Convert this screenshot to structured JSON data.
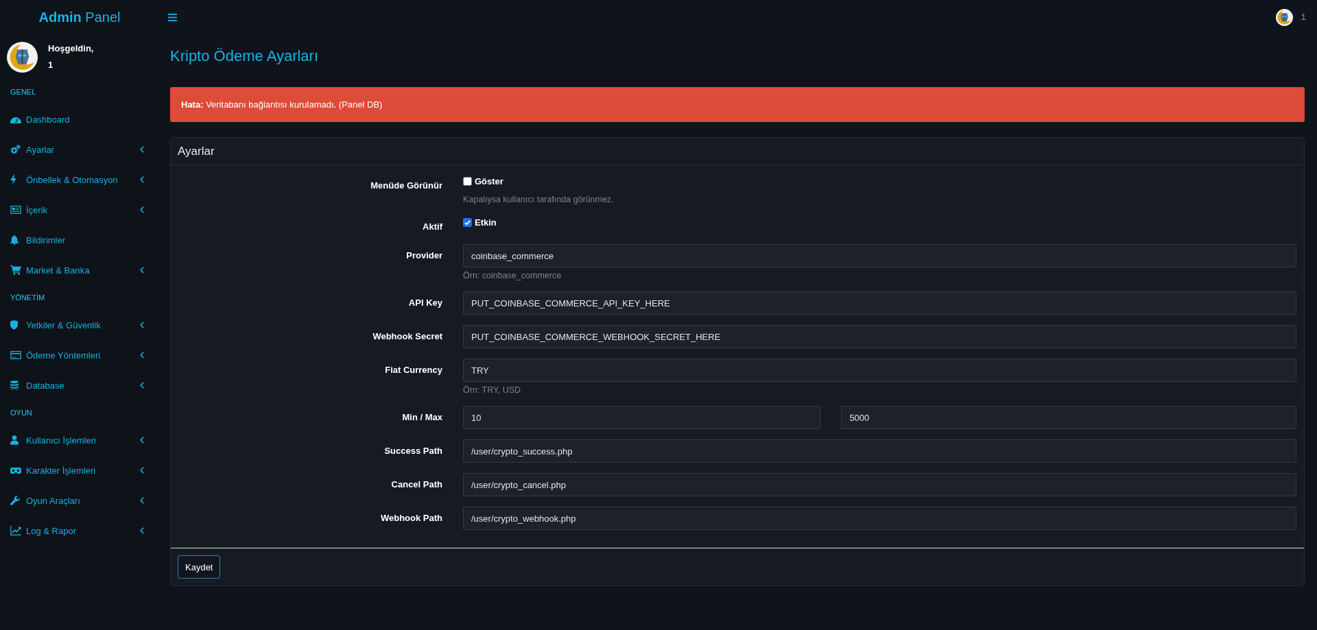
{
  "sidebar": {
    "brand": "**Admin** Panel",
    "user": {
      "greeting": "Hoşgeldin,",
      "name": "1"
    },
    "sections": [
      {
        "heading": "GENEL",
        "items": [
          {
            "label": "Dashboard",
            "submenu": false
          },
          {
            "label": "Ayarlar",
            "submenu": true
          },
          {
            "label": "Önbellek & Otomasyon",
            "submenu": true
          },
          {
            "label": "İçerik",
            "submenu": true
          },
          {
            "label": "Bildirimler",
            "submenu": false
          },
          {
            "label": "Market & Banka",
            "submenu": true
          }
        ]
      },
      {
        "heading": "YÖNETİM",
        "items": [
          {
            "label": "Yetkiler & Güvenlik",
            "submenu": true
          },
          {
            "label": "Ödeme Yöntemleri",
            "submenu": true
          },
          {
            "label": "Database",
            "submenu": true
          }
        ]
      },
      {
        "heading": "OYUN",
        "items": [
          {
            "label": "Kullanıcı İşlemleri",
            "submenu": true
          },
          {
            "label": "Karakter İşlemleri",
            "submenu": true
          },
          {
            "label": "Oyun Araçları",
            "submenu": true
          },
          {
            "label": "Log & Rapor",
            "submenu": true
          }
        ]
      }
    ]
  },
  "topbar": {
    "user_name": "1"
  },
  "page_title": "Kripto Ödeme Ayarları",
  "alert": {
    "text": "**Hata:** Veritabanı bağlantısı kurulamadı. (Panel DB)"
  },
  "settings_card": {
    "title": "Ayarlar",
    "fields": [
      {
        "kind": "checkbox",
        "label": "Menüde Görünür",
        "option": "Göster",
        "checked": false,
        "help": "Kapalıysa kullanıcı tarafında görünmez."
      },
      {
        "kind": "checkbox",
        "label": "Aktif",
        "option": "Etkin",
        "checked": true
      },
      {
        "kind": "text",
        "label": "Provider",
        "value": "coinbase_commerce",
        "help": "Örn: coinbase_commerce"
      },
      {
        "kind": "text",
        "label": "API Key",
        "value": "PUT_COINBASE_COMMERCE_API_KEY_HERE"
      },
      {
        "kind": "text",
        "label": "Webhook Secret",
        "value": "PUT_COINBASE_COMMERCE_WEBHOOK_SECRET_HERE"
      },
      {
        "kind": "text",
        "label": "Fiat Currency",
        "value": "TRY",
        "help": "Örn: TRY, USD"
      },
      {
        "kind": "range",
        "label": "Min / Max",
        "values": [
          "10",
          "5000"
        ]
      },
      {
        "kind": "text",
        "label": "Success Path",
        "value": "/user/crypto_success.php"
      },
      {
        "kind": "text",
        "label": "Cancel Path",
        "value": "/user/crypto_cancel.php"
      },
      {
        "kind": "text",
        "label": "Webhook Path",
        "value": "/user/crypto_webhook.php"
      }
    ],
    "submit": "Kaydet"
  }
}
